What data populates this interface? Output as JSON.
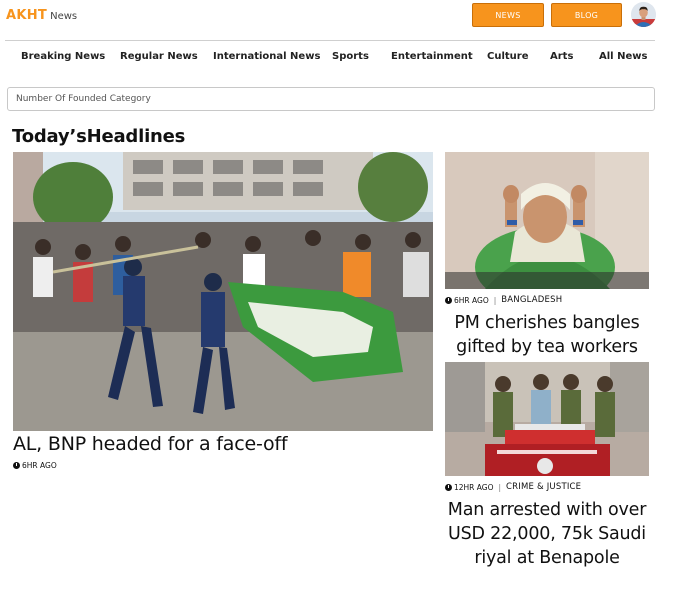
{
  "header": {
    "logo_main": "AKHT",
    "logo_sub": "News",
    "news_button": "NEWS",
    "blog_button": "BLOG",
    "avatar_icon": "user-avatar"
  },
  "nav": {
    "items": [
      {
        "label": "Breaking News"
      },
      {
        "label": "Regular News"
      },
      {
        "label": "International News"
      },
      {
        "label": "Sports"
      },
      {
        "label": "Entertainment"
      },
      {
        "label": "Culture"
      },
      {
        "label": "Arts"
      },
      {
        "label": "All News"
      }
    ]
  },
  "search": {
    "placeholder": "Number Of Founded Category",
    "value": ""
  },
  "section": {
    "title": "Today’sHeadlines"
  },
  "headlines": {
    "main": {
      "title": "AL, BNP headed for a face-off",
      "time": "6HR AGO",
      "image_icon": "protest-photo"
    },
    "side": [
      {
        "title": "PM cherishes bangles gifted by tea workers",
        "time": "6HR AGO",
        "category": "BANGLADESH",
        "image_icon": "portrait-photo"
      },
      {
        "title": "Man arrested with over USD 22,000, 75k Saudi riyal at Benapole",
        "time": "12HR AGO",
        "category": "CRIME & JUSTICE",
        "image_icon": "arrest-photo"
      }
    ]
  },
  "colors": {
    "accent": "#f7941d",
    "text": "#111111",
    "divider": "#cfcfcf"
  }
}
